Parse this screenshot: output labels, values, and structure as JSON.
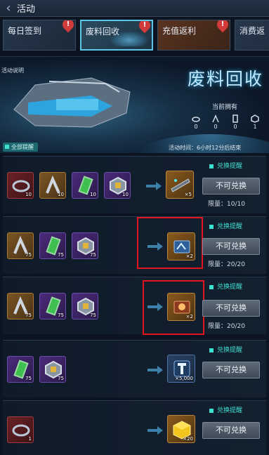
{
  "header": {
    "title": "活动"
  },
  "tabs": [
    {
      "label": "每日签到",
      "badge": "!"
    },
    {
      "label": "废料回收",
      "badge": "!"
    },
    {
      "label": "充值返利",
      "badge": "!"
    },
    {
      "label": "消费返"
    }
  ],
  "banner": {
    "explain": "活动说明",
    "title": "废料回收",
    "own_label": "当前拥有",
    "own_counts": [
      "0",
      "0",
      "0",
      "1"
    ],
    "time_label": "活动时间：",
    "time_value": "6小时12分后结束",
    "remind_all": "全部提醒"
  },
  "rows": [
    {
      "costs": [
        "10",
        "10",
        "10",
        "10"
      ],
      "reward_count": "×5",
      "remind": "兑换提醒",
      "button": "不可兑换",
      "limit_label": "限量：",
      "limit": "10/10"
    },
    {
      "costs": [
        "75",
        "75",
        "75"
      ],
      "reward_count": "×2",
      "remind": "兑换提醒",
      "button": "不可兑换",
      "limit_label": "限量：",
      "limit": "20/20"
    },
    {
      "costs": [
        "75",
        "75",
        "75"
      ],
      "reward_count": "×2",
      "remind": "兑换提醒",
      "button": "不可兑换",
      "limit_label": "限量：",
      "limit": "20/20"
    },
    {
      "costs": [
        "75",
        "75"
      ],
      "reward_count": "×5,000",
      "remind": "兑换提醒",
      "button": "不可兑换"
    },
    {
      "costs": [
        "1"
      ],
      "reward_count": "×20",
      "remind": "兑换提醒",
      "button": "不可兑换"
    }
  ],
  "colors": {
    "accent": "#3fe0d0",
    "highlight": "#e4141c",
    "title_glow": "#2aa8e0"
  }
}
